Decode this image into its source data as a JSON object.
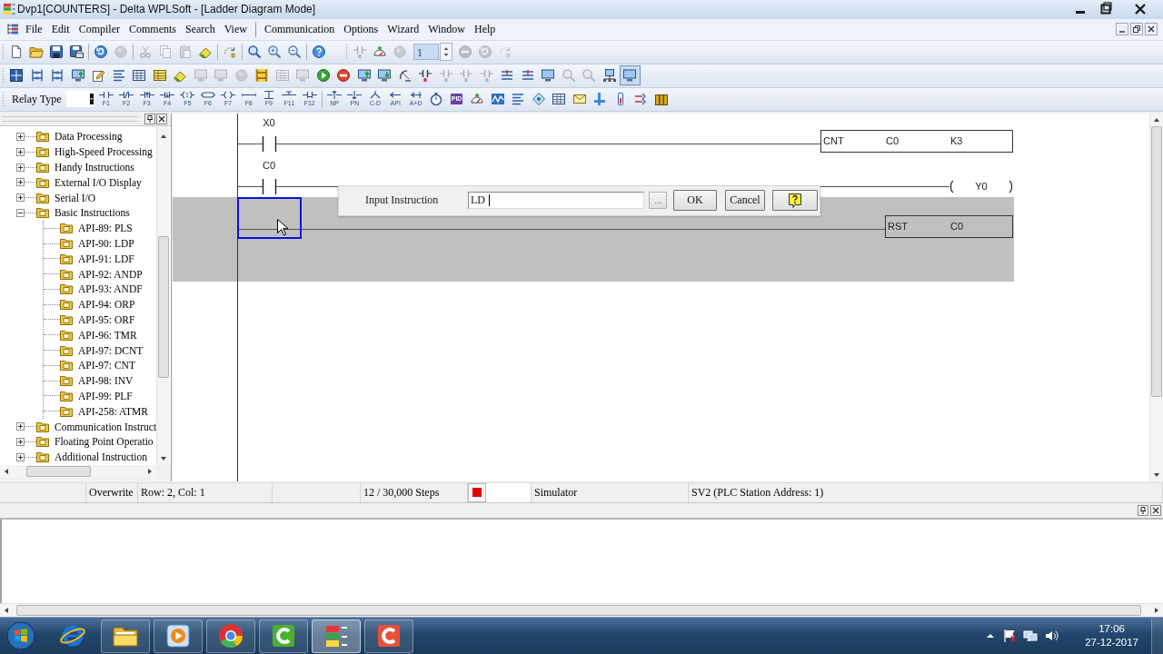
{
  "window": {
    "title": "Dvp1[COUNTERS] - Delta WPLSoft - [Ladder Diagram Mode]"
  },
  "menu_bar": {
    "items": [
      {
        "kind": "menu",
        "label": "File"
      },
      {
        "kind": "menu",
        "label": "Edit"
      },
      {
        "kind": "menu",
        "label": "Compiler"
      },
      {
        "kind": "menu",
        "label": "Comments"
      },
      {
        "kind": "menu",
        "label": "Search"
      },
      {
        "kind": "menu",
        "label": "View"
      },
      {
        "kind": "separator"
      },
      {
        "kind": "menu",
        "label": "Communication"
      },
      {
        "kind": "menu",
        "label": "Options"
      },
      {
        "kind": "menu",
        "label": "Wizard"
      },
      {
        "kind": "menu",
        "label": "Window"
      },
      {
        "kind": "menu",
        "label": "Help"
      }
    ]
  },
  "standard_toolbar": {
    "buttons": [
      {
        "disabled": false
      },
      {
        "disabled": false
      },
      {
        "disabled": false
      },
      {
        "disabled": false
      },
      {
        "disabled": false
      },
      {
        "disabled": true
      },
      {
        "disabled": true
      },
      {
        "disabled": true
      },
      {
        "disabled": true
      },
      {
        "disabled": false
      },
      {
        "disabled": false
      },
      {
        "disabled": false
      },
      {
        "disabled": false
      },
      {
        "disabled": false
      },
      {
        "disabled": false
      },
      {
        "disabled": true
      },
      {
        "disabled": false
      },
      {
        "disabled": true
      },
      {
        "disabled": true
      },
      {
        "disabled": true
      },
      {
        "disabled": true
      }
    ],
    "step_field": {
      "value": "1"
    }
  },
  "edit_toolbar": {
    "buttons": [
      {
        "disabled": false,
        "pressed": false
      },
      {
        "disabled": false,
        "pressed": false
      },
      {
        "disabled": false,
        "pressed": false
      },
      {
        "disabled": false,
        "pressed": false
      },
      {
        "disabled": false,
        "pressed": false
      },
      {
        "disabled": false,
        "pressed": false
      },
      {
        "disabled": false,
        "pressed": false
      },
      {
        "disabled": false,
        "pressed": false
      },
      {
        "disabled": false,
        "pressed": false
      },
      {
        "disabled": true,
        "pressed": false
      },
      {
        "disabled": true,
        "pressed": false
      },
      {
        "disabled": true,
        "pressed": false
      },
      {
        "disabled": false,
        "pressed": false
      },
      {
        "disabled": true,
        "pressed": false
      },
      {
        "disabled": true,
        "pressed": false
      },
      {
        "disabled": false,
        "pressed": false
      },
      {
        "disabled": false,
        "pressed": false
      },
      {
        "disabled": false,
        "pressed": false
      },
      {
        "disabled": false,
        "pressed": false
      },
      {
        "disabled": false,
        "pressed": false
      },
      {
        "disabled": false,
        "pressed": false
      },
      {
        "disabled": true,
        "pressed": false
      },
      {
        "disabled": true,
        "pressed": false
      },
      {
        "disabled": true,
        "pressed": false
      },
      {
        "disabled": false,
        "pressed": false
      },
      {
        "disabled": false,
        "pressed": false
      },
      {
        "disabled": false,
        "pressed": false
      },
      {
        "disabled": true,
        "pressed": false
      },
      {
        "disabled": true,
        "pressed": false
      },
      {
        "disabled": false,
        "pressed": false
      },
      {
        "disabled": false,
        "pressed": true
      }
    ]
  },
  "relay_toolbar": {
    "label": "Relay Type",
    "buttons": [
      {
        "label": "F1"
      },
      {
        "label": "F2"
      },
      {
        "label": "F3"
      },
      {
        "label": "F4"
      },
      {
        "label": "F5"
      },
      {
        "label": "F6"
      },
      {
        "label": "F7"
      },
      {
        "label": "F8"
      },
      {
        "label": "F9"
      },
      {
        "label": "F11"
      },
      {
        "label": "F12"
      },
      {
        "label": "NP"
      },
      {
        "label": "PN"
      },
      {
        "label": "C-D"
      },
      {
        "label": "API"
      },
      {
        "label": "A+D"
      }
    ],
    "pid_button": {
      "label": "PID"
    }
  },
  "instruction_tree": {
    "items": [
      {
        "label": "Data Processing",
        "expanded": false
      },
      {
        "label": "High-Speed Processing",
        "expanded": false
      },
      {
        "label": "Handy Instructions",
        "expanded": false
      },
      {
        "label": "External I/O Display",
        "expanded": false
      },
      {
        "label": "Serial I/O",
        "expanded": false
      },
      {
        "label": "Basic Instructions",
        "expanded": true,
        "children": [
          {
            "label": "API-89: PLS"
          },
          {
            "label": "API-90: LDP"
          },
          {
            "label": "API-91: LDF"
          },
          {
            "label": "API-92: ANDP"
          },
          {
            "label": "API-93: ANDF"
          },
          {
            "label": "API-94: ORP"
          },
          {
            "label": "API-95: ORF"
          },
          {
            "label": "API-96: TMR"
          },
          {
            "label": "API-97: DCNT"
          },
          {
            "label": "API-97: CNT"
          },
          {
            "label": "API-98: INV"
          },
          {
            "label": "API-99: PLF"
          },
          {
            "label": "API-258: ATMR"
          }
        ]
      },
      {
        "label": "Communication Instruct",
        "expanded": false
      },
      {
        "label": "Floating Point Operatio",
        "expanded": false
      },
      {
        "label": "Additional Instruction",
        "expanded": false
      }
    ]
  },
  "ladder": {
    "rungs": [
      {
        "contact": {
          "operand": "X0"
        },
        "output": {
          "kind": "box",
          "mnemonic": "CNT",
          "operands": [
            "C0",
            "K3"
          ]
        },
        "selected": false,
        "cursor": false
      },
      {
        "contact": {
          "operand": "C0"
        },
        "output": {
          "kind": "coil",
          "operand": "Y0"
        },
        "selected": false,
        "cursor": false
      },
      {
        "output": {
          "kind": "box",
          "mnemonic": "RST",
          "operands": [
            "C0"
          ]
        },
        "selected": true,
        "cursor": true
      }
    ]
  },
  "input_dialog": {
    "label": "Input Instruction",
    "value": "LD",
    "browse_button": "...",
    "buttons": [
      "OK",
      "Cancel"
    ]
  },
  "status_bar": {
    "mode": "Overwrite",
    "position": "Row: 2, Col: 1",
    "steps": "12 / 30,000 Steps",
    "running": false,
    "connection": "Simulator",
    "station": "SV2 (PLC Station Address: 1)"
  },
  "taskbar": {
    "buttons": [
      {
        "running": false,
        "selected": false
      },
      {
        "running": true,
        "selected": false
      },
      {
        "running": true,
        "selected": false
      },
      {
        "running": true,
        "selected": false
      },
      {
        "running": true,
        "selected": false
      },
      {
        "running": true,
        "selected": true
      },
      {
        "running": true,
        "selected": false
      }
    ],
    "clock": {
      "time": "17:06",
      "date": "27-12-2017"
    }
  }
}
